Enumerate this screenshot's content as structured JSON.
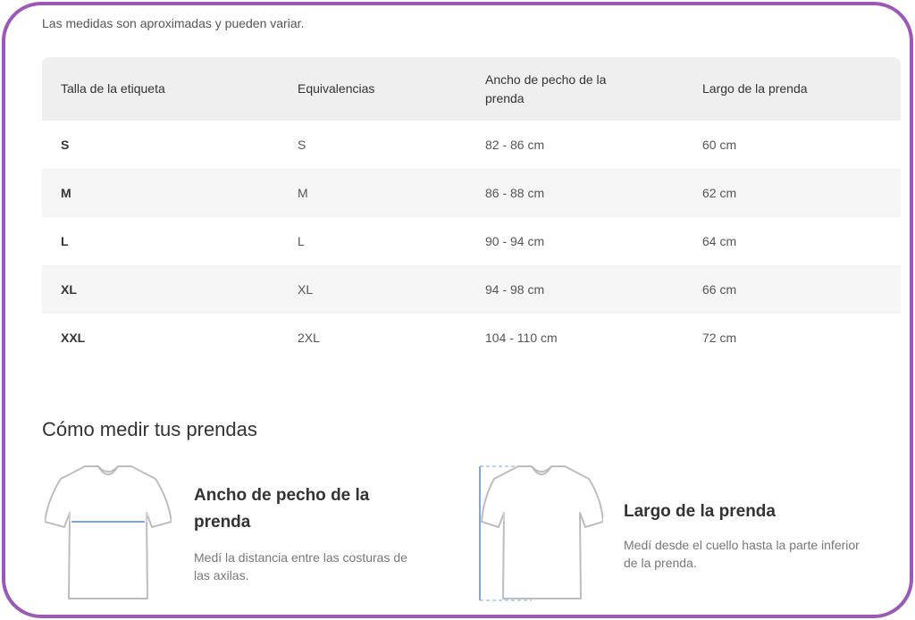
{
  "note": "Las medidas son aproximadas y pueden variar.",
  "table": {
    "headers": [
      "Talla de la etiqueta",
      "Equivalencias",
      "Ancho de pecho de la prenda",
      "Largo de la prenda"
    ],
    "rows": [
      [
        "S",
        "S",
        "82 - 86 cm",
        "60 cm"
      ],
      [
        "M",
        "M",
        "86 - 88 cm",
        "62 cm"
      ],
      [
        "L",
        "L",
        "90 - 94 cm",
        "64 cm"
      ],
      [
        "XL",
        "XL",
        "94 - 98 cm",
        "66 cm"
      ],
      [
        "XXL",
        "2XL",
        "104 - 110 cm",
        "72 cm"
      ]
    ]
  },
  "howto": {
    "title": "Cómo medir tus prendas",
    "items": [
      {
        "title": "Ancho de pecho de la prenda",
        "desc": "Medí la distancia entre las costuras de las axilas.",
        "icon": "tshirt-chest-icon"
      },
      {
        "title": "Largo de la prenda",
        "desc": "Medí desde el cuello hasta la parte inferior de la prenda.",
        "icon": "tshirt-length-icon"
      }
    ]
  },
  "colors": {
    "frame": "#9b59b6",
    "measure_line": "#7aa7e6"
  }
}
